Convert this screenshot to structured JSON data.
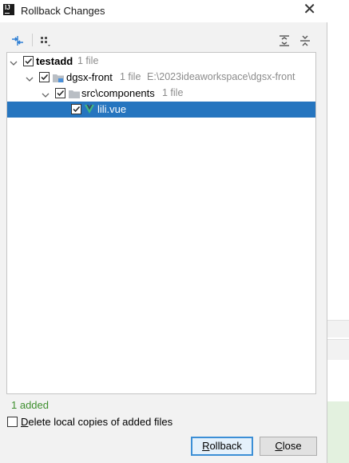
{
  "window": {
    "title": "Rollback Changes",
    "app_icon_text": "IJ",
    "close_glyph": "✕"
  },
  "toolbar": {
    "icons": [
      "merge-arrows-icon",
      "group-by-icon",
      "expand-all-icon",
      "collapse-all-icon"
    ]
  },
  "tree": {
    "root": {
      "label": "testadd",
      "count": "1 file",
      "checked": true
    },
    "module": {
      "label": "dgsx-front",
      "count": "1 file",
      "path": "E:\\2023ideaworkspace\\dgsx-front",
      "checked": true
    },
    "folder": {
      "label": "src\\components",
      "count": "1 file",
      "checked": true
    },
    "file": {
      "label": "lili.vue",
      "checked": true,
      "selected": true
    }
  },
  "summary": "1 added",
  "option": {
    "label_mnemonic": "D",
    "label_rest": "elete local copies of added files",
    "checked": false
  },
  "buttons": {
    "rollback_mnemonic": "R",
    "rollback_rest": "ollback",
    "close_mnemonic": "C",
    "close_rest": "lose"
  },
  "colors": {
    "selection": "#2675bf",
    "summary_green": "#3e8f2e",
    "vue_green": "#41b883",
    "primary_border": "#3c8fd6"
  }
}
